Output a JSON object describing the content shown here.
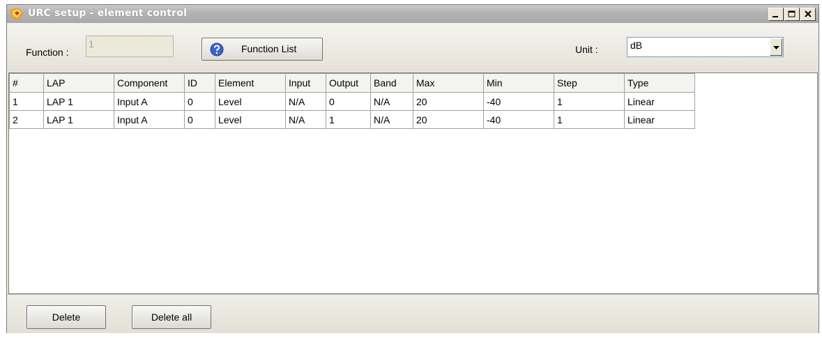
{
  "window": {
    "title": "URC setup - element control"
  },
  "toolbar": {
    "function_label": "Function :",
    "function_value": "1",
    "function_list_label": "Function List",
    "unit_label": "Unit :",
    "unit_value": "dB"
  },
  "grid": {
    "columns": [
      "#",
      "LAP",
      "Component",
      "ID",
      "Element",
      "Input",
      "Output",
      "Band",
      "Max",
      "Min",
      "Step",
      "Type"
    ],
    "rows": [
      [
        "1",
        "LAP 1",
        "Input A",
        "0",
        "Level",
        "N/A",
        "0",
        "N/A",
        "20",
        "-40",
        "1",
        "Linear"
      ],
      [
        "2",
        "LAP 1",
        "Input A",
        "0",
        "Level",
        "N/A",
        "1",
        "N/A",
        "20",
        "-40",
        "1",
        "Linear"
      ]
    ]
  },
  "actions": {
    "delete_label": "Delete",
    "delete_all_label": "Delete all"
  },
  "icons": [
    "app-icon",
    "minimize-icon",
    "maximize-icon",
    "close-icon",
    "help-icon",
    "dropdown-arrow-icon"
  ],
  "colors": {
    "window_bg": "#ece9d8",
    "titlebar": "#b3b3b3",
    "help_icon": "#3a64c8"
  }
}
